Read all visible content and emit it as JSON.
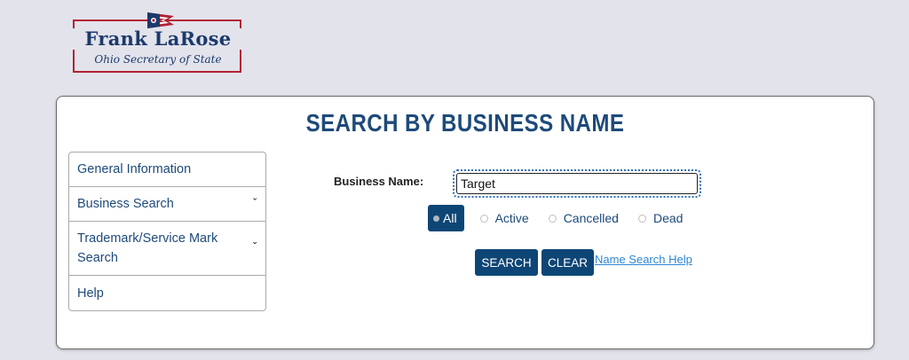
{
  "logo": {
    "name": "Frank LaRose",
    "subtitle": "Ohio Secretary of State",
    "colors": {
      "red": "#b22234",
      "blue": "#1b3a6b"
    }
  },
  "page_title": "SEARCH BY BUSINESS NAME",
  "sidebar": {
    "items": [
      {
        "label": "General Information",
        "has_chevron": false
      },
      {
        "label": "Business Search",
        "has_chevron": true
      },
      {
        "label": "Trademark/Service Mark Search",
        "has_chevron": true
      },
      {
        "label": "Help",
        "has_chevron": false
      }
    ],
    "chevron_icon": "chevron-down-icon"
  },
  "form": {
    "business_name_label": "Business Name:",
    "business_name_value": "Target",
    "status_options": [
      {
        "label": "All",
        "selected": true
      },
      {
        "label": "Active",
        "selected": false
      },
      {
        "label": "Cancelled",
        "selected": false
      },
      {
        "label": "Dead",
        "selected": false
      }
    ],
    "search_button": "SEARCH",
    "clear_button": "CLEAR",
    "help_link": "Name Search Help"
  },
  "colors": {
    "page_bg": "#e3e3ec",
    "accent": "#0d4675",
    "title": "#1d4a7a",
    "link": "#2e86d6"
  }
}
